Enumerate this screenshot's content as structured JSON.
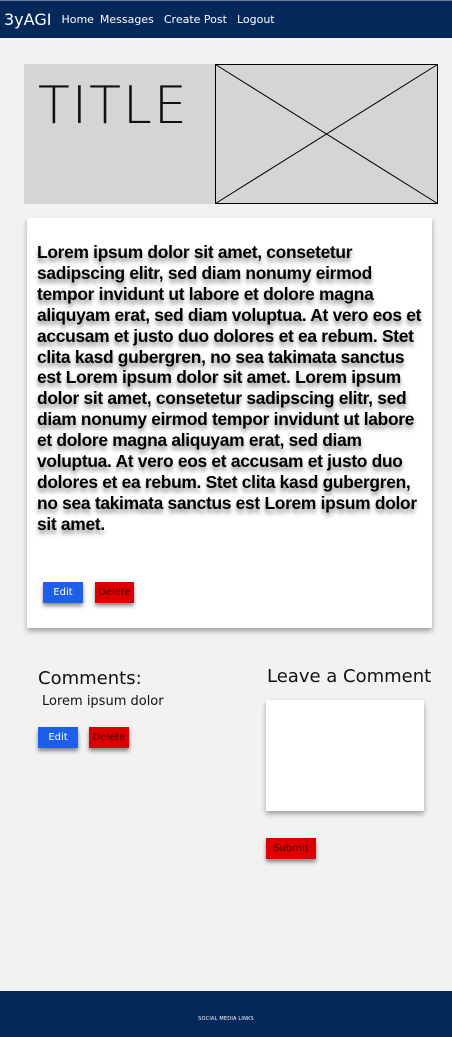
{
  "navbar": {
    "brand": "3yAGI",
    "links": [
      "Home",
      "Messages",
      "Create Post",
      "Logout"
    ]
  },
  "post": {
    "title": "TITLE",
    "image_alt": "image placeholder",
    "body": "Lorem ipsum dolor sit amet, consetetur sadipscing elitr, sed diam nonumy eirmod tempor invidunt ut labore et dolore magna aliquyam erat, sed diam voluptua. At vero eos et accusam et justo duo dolores et ea rebum. Stet clita kasd gubergren, no sea takimata sanctus est Lorem ipsum dolor sit amet. Lorem ipsum dolor sit amet, consetetur sadipscing elitr, sed diam nonumy eirmod tempor invidunt ut labore et dolore magna aliquyam erat, sed diam voluptua. At vero eos et accusam et justo duo dolores et ea rebum. Stet clita kasd gubergren, no sea takimata sanctus est Lorem ipsum dolor sit amet.",
    "edit_label": "Edit",
    "delete_label": "Delete"
  },
  "comments": {
    "title": "Comments:",
    "items": [
      {
        "text": "Lorem ipsum dolor",
        "edit_label": "Edit",
        "delete_label": "Delete"
      }
    ]
  },
  "leave_comment": {
    "title": "Leave a Comment",
    "placeholder": "",
    "submit_label": "Submit"
  },
  "footer": {
    "text": "SOCIAL MEDIA LINKS"
  },
  "colors": {
    "nav_bg": "#032859",
    "primary_button": "#1d5fe6",
    "danger_button": "#dc0000",
    "page_bg": "#f2f2f2",
    "hero_bg": "#d5d5d5"
  }
}
